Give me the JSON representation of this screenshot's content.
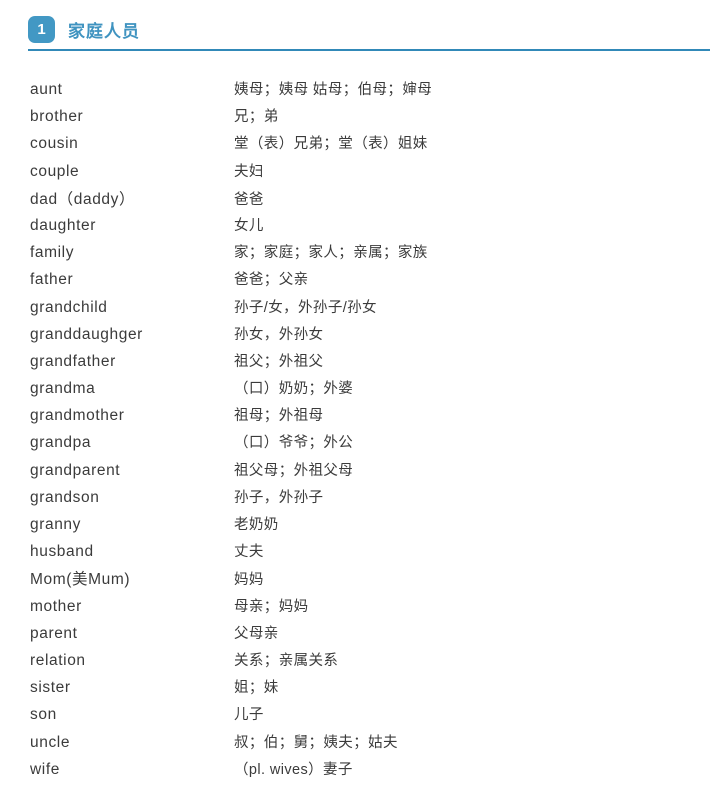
{
  "section": {
    "number": "1",
    "title": "家庭人员",
    "accent_color": "#3f93c0",
    "badge_color": "#4298c4",
    "rule_color": "#3189b8"
  },
  "vocabulary": [
    {
      "term": "aunt",
      "meaning": "姨母；姨母 姑母；伯母；婶母"
    },
    {
      "term": "brother",
      "meaning": "兄；弟"
    },
    {
      "term": "cousin",
      "meaning": "堂（表）兄弟；堂（表）姐妹"
    },
    {
      "term": "couple",
      "meaning": "夫妇"
    },
    {
      "term": "dad（daddy）",
      "meaning": "爸爸"
    },
    {
      "term": "daughter",
      "meaning": "女儿"
    },
    {
      "term": "family",
      "meaning": "家；家庭；家人；亲属；家族"
    },
    {
      "term": "father",
      "meaning": "爸爸；父亲"
    },
    {
      "term": "grandchild",
      "meaning": "孙子/女，外孙子/孙女"
    },
    {
      "term": "granddaughger",
      "meaning": "孙女，外孙女"
    },
    {
      "term": "grandfather",
      "meaning": "祖父；外祖父"
    },
    {
      "term": "grandma",
      "meaning": "（口）奶奶；外婆"
    },
    {
      "term": "grandmother",
      "meaning": "祖母；外祖母"
    },
    {
      "term": "grandpa",
      "meaning": "（口）爷爷；外公"
    },
    {
      "term": "grandparent",
      "meaning": "祖父母；外祖父母"
    },
    {
      "term": "grandson",
      "meaning": "孙子，外孙子"
    },
    {
      "term": "granny",
      "meaning": "老奶奶"
    },
    {
      "term": "husband",
      "meaning": "丈夫"
    },
    {
      "term": "Mom(美Mum)",
      "meaning": "妈妈"
    },
    {
      "term": "mother",
      "meaning": "母亲；妈妈"
    },
    {
      "term": "parent",
      "meaning": "父母亲"
    },
    {
      "term": "relation",
      "meaning": "关系；亲属关系"
    },
    {
      "term": "sister",
      "meaning": "姐；妹"
    },
    {
      "term": "son",
      "meaning": "儿子"
    },
    {
      "term": "uncle",
      "meaning": "叔；伯；舅；姨夫；姑夫"
    },
    {
      "term": "wife",
      "meaning": "（pl. wives）妻子"
    }
  ]
}
